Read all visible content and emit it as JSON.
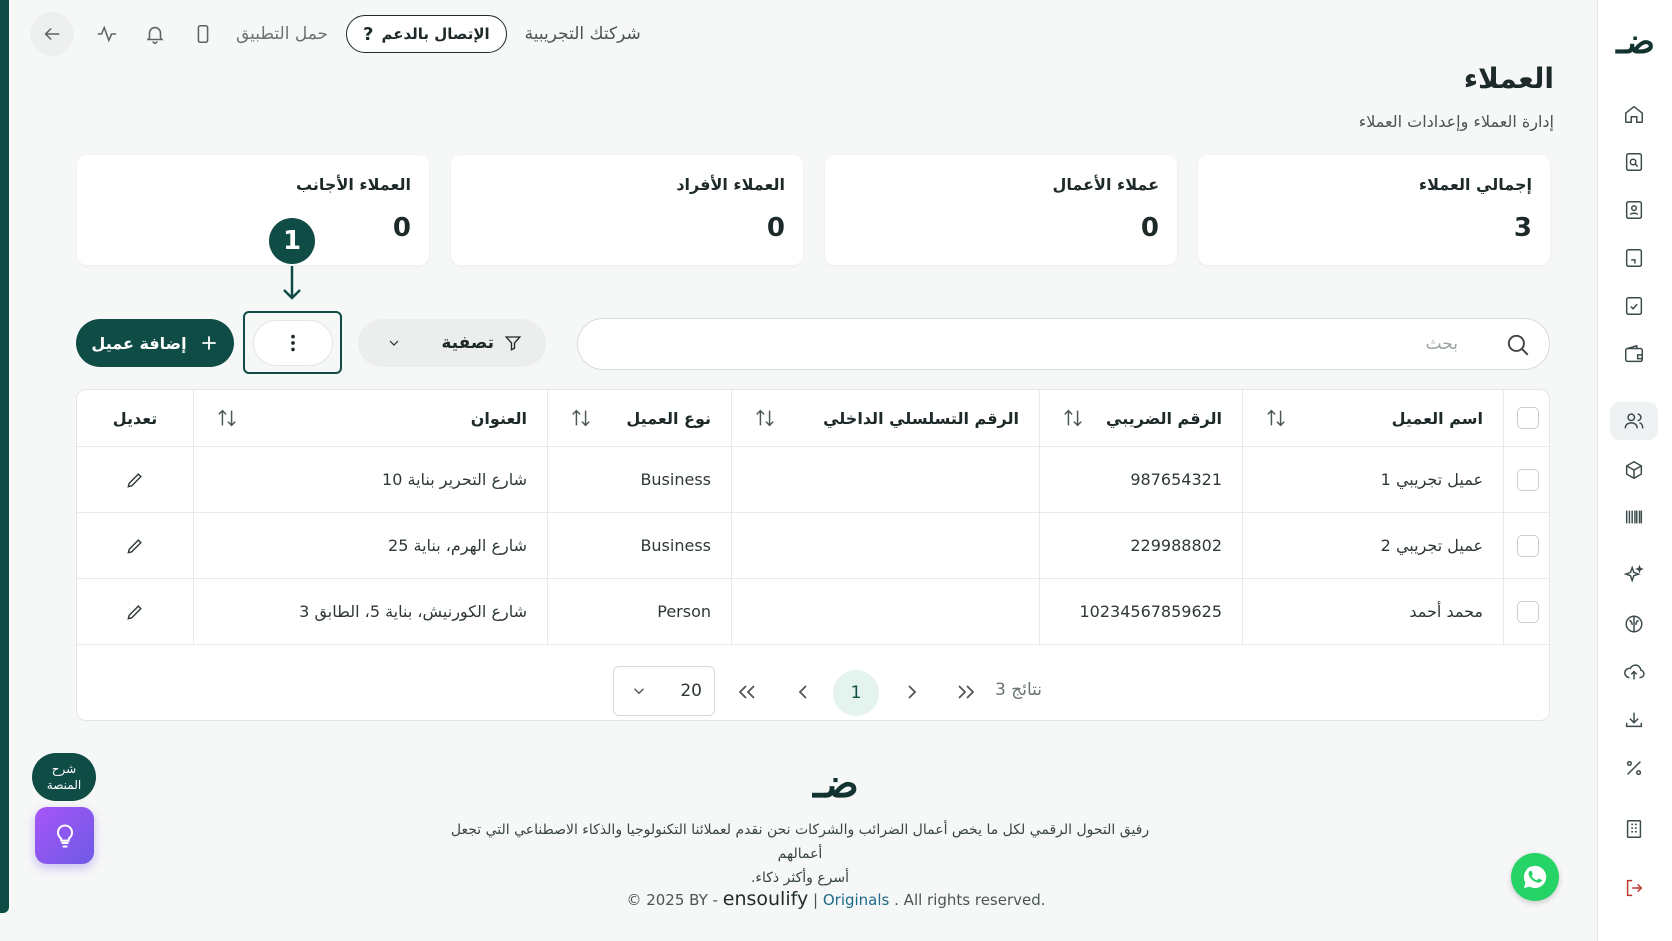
{
  "topbar": {
    "download_app": "حمل التطبيق",
    "support_label": "الإتصال بالدعم",
    "company_name": "شركتك التجريبية"
  },
  "header": {
    "title": "العملاء",
    "subtitle": "إدارة العملاء وإعدادات العملاء"
  },
  "stats": [
    {
      "label": "إجمالي العملاء",
      "value": "3"
    },
    {
      "label": "عملاء الأعمال",
      "value": "0"
    },
    {
      "label": "العملاء الأفراد",
      "value": "0"
    },
    {
      "label": "العملاء الأجانب",
      "value": "0"
    }
  ],
  "annotation": {
    "marker": "1"
  },
  "toolbar": {
    "add_label": "إضافة عميل",
    "filter_label": "تصفية",
    "search_placeholder": "بحث"
  },
  "table": {
    "headers": {
      "name": "اسم العميل",
      "tax": "الرقم الضريبي",
      "serial": "الرقم التسلسلي الداخلي",
      "type": "نوع العميل",
      "address": "العنوان",
      "edit": "تعديل"
    },
    "rows": [
      {
        "name": "عميل تجريبي 1",
        "tax": "987654321",
        "serial": "",
        "type": "Business",
        "address": "شارع التحرير بناية 10"
      },
      {
        "name": "عميل تجريبي 2",
        "tax": "229988802",
        "serial": "",
        "type": "Business",
        "address": "شارع الهرم، بناية 25"
      },
      {
        "name": "محمد أحمد",
        "tax": "10234567859625",
        "serial": "",
        "type": "Person",
        "address": "شارع الكورنيش، بناية 5، الطابق 3"
      }
    ]
  },
  "pagination": {
    "page_size": "20",
    "current_page": "1",
    "results": "3 نتائج"
  },
  "footer": {
    "tagline_line1": "رفيق التحول الرقمي لكل ما يخص أعمال الضرائب والشركات نحن نقدم لعملائنا التكنولوجيا والذكاء الاصطناعي التي تجعل أعمالهم",
    "tagline_line2": "أسرع وأكثر ذكاء.",
    "copyright_prefix": "© 2025 BY -",
    "brand": "ensoulify",
    "separator": "|",
    "originals": "Originals",
    "rights": ". All rights reserved."
  },
  "floating": {
    "guide_line1": "شرح",
    "guide_line2": "المنصة"
  },
  "colors": {
    "primary": "#0f4c45",
    "background": "#f6f7f7",
    "whatsapp": "#25d366",
    "bulb": "#8b5cf6"
  }
}
